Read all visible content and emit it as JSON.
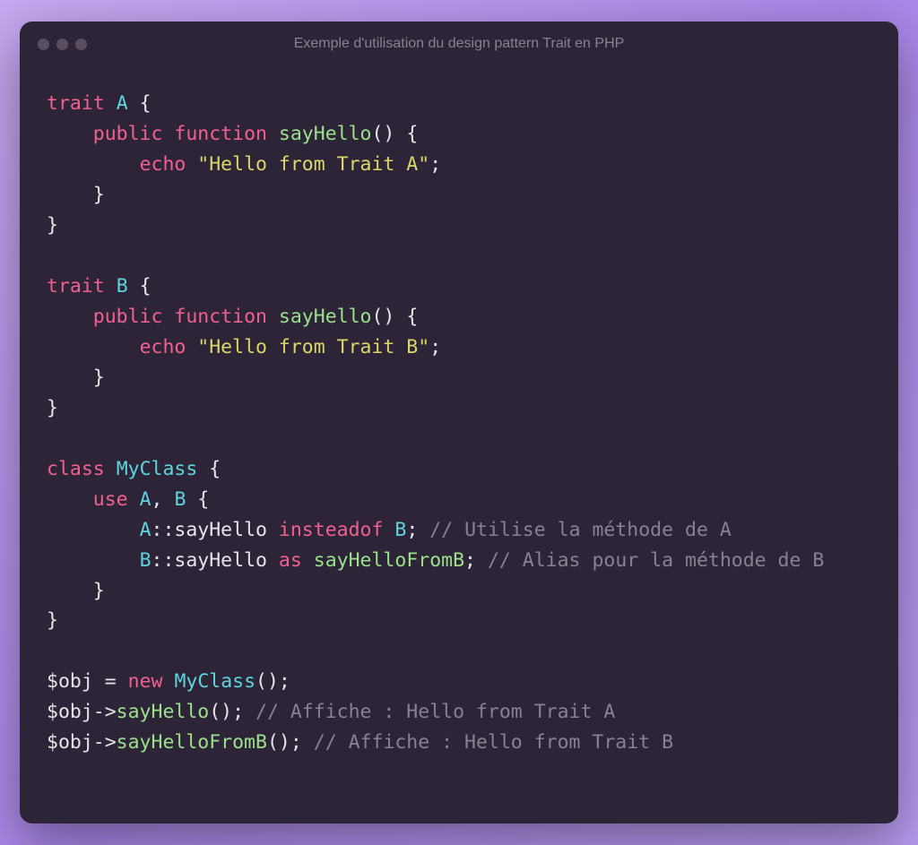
{
  "title": "Exemple d'utilisation du design pattern Trait en PHP",
  "c": {
    "trait": "trait",
    "class": "class",
    "public": "public",
    "function": "function",
    "echo": "echo",
    "use": "use",
    "insteadof": "insteadof",
    "as": "as",
    "new": "new",
    "A": "A",
    "B": "B",
    "MyClass": "MyClass",
    "sayHello": "sayHello",
    "sayHelloFromB": "sayHelloFromB",
    "strA": "\"Hello from Trait A\"",
    "strB": "\"Hello from Trait B\"",
    "obj": "$obj",
    "cm1": "// Utilise la méthode de A",
    "cm2": "// Alias pour la méthode de B",
    "cm3": "// Affiche : Hello from Trait A",
    "cm4": "// Affiche : Hello from Trait B"
  }
}
